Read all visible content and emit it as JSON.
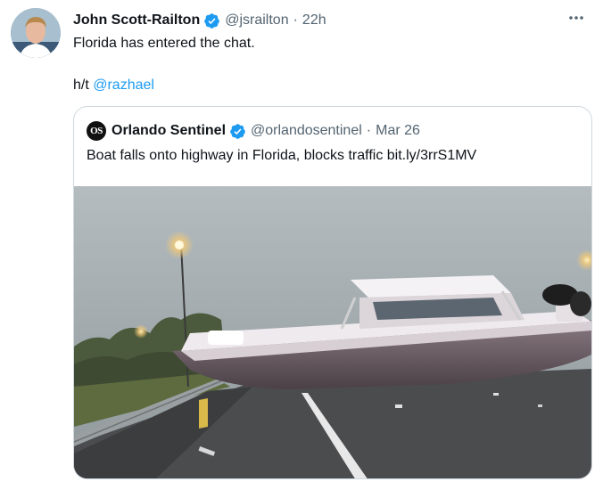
{
  "tweet": {
    "author_name": "John Scott-Railton",
    "author_handle": "@jsrailton",
    "separator": "·",
    "time": "22h",
    "text_line1": "Florida has entered the chat.",
    "text_prefix": "h/t ",
    "mention": "@razhael",
    "more_icon": "more-horizontal-icon"
  },
  "quoted": {
    "avatar_text": "OS",
    "author_name": "Orlando Sentinel",
    "author_handle": "@orlandosentinel",
    "separator": "·",
    "date": "Mar 26",
    "text": "Boat falls onto highway in Florida, blocks traffic bit.ly/3rrS1MV"
  },
  "colors": {
    "link": "#1d9bf0",
    "secondary_text": "#536471",
    "verified_badge": "#1d9bf0",
    "border": "#cfd9de"
  }
}
